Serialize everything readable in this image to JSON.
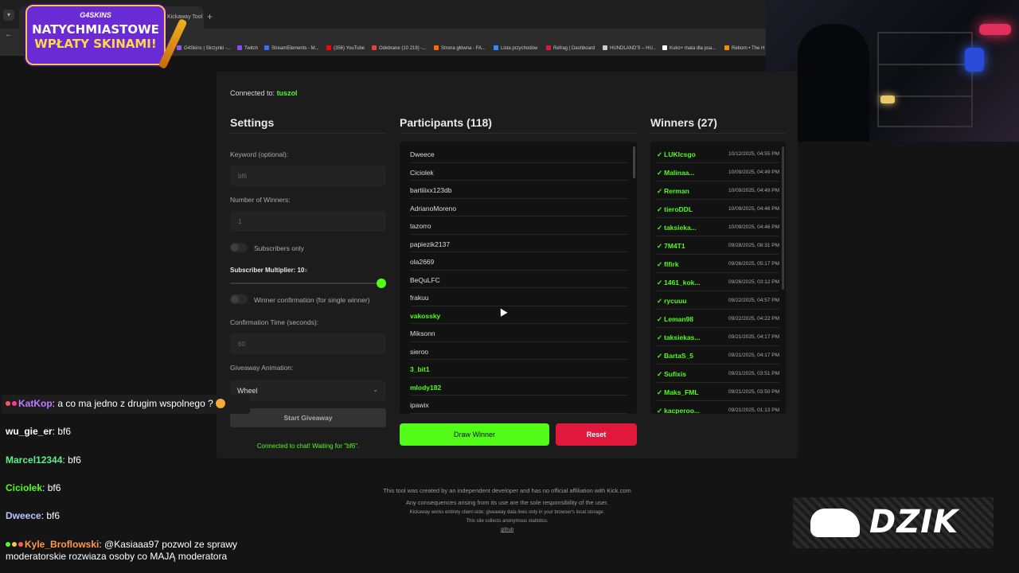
{
  "browser": {
    "tab_title": "Kickaway Tool",
    "bookmarks": [
      {
        "label": "G4Skins | Skrzynki -...",
        "color": "#8a5cf6"
      },
      {
        "label": "Twitch",
        "color": "#9146ff"
      },
      {
        "label": "StreamElements - M...",
        "color": "#3b6cff"
      },
      {
        "label": "(356) YouTube",
        "color": "#ff0000"
      },
      {
        "label": "Odebrane (10 219) -...",
        "color": "#ea4335"
      },
      {
        "label": "Strona główna - FA...",
        "color": "#ff6a00"
      },
      {
        "label": "Lista przychodów",
        "color": "#2d8cff"
      },
      {
        "label": "Refrag | Dashboard",
        "color": "#e0183c"
      },
      {
        "label": "HUNDLAND'S – HU...",
        "color": "#cccccc"
      },
      {
        "label": "Kuko+ mata dla psa...",
        "color": "#ffffff"
      },
      {
        "label": "Reborn • The H",
        "color": "#ff8a00"
      }
    ]
  },
  "promo": {
    "brand": "G4SKINS",
    "line1": "NATYCHMIASTOWE",
    "line2": "WPŁATY SKINAMI!"
  },
  "panel": {
    "connected_label": "Connected to:",
    "channel": "tuszol",
    "settings_title": "Settings",
    "keyword_label": "Keyword (optional):",
    "keyword_value": "bf6",
    "winners_label": "Number of Winners:",
    "winners_value": "1",
    "subscribers_only_label": "Subscribers only",
    "multiplier_label": "Subscriber Multiplier: 10",
    "multiplier_unit": "x",
    "multiplier_level": 1.0,
    "winner_confirmation_label": "Winner confirmation (for single winner)",
    "confirmation_time_label": "Confirmation Time (seconds):",
    "confirmation_time_value": "60",
    "animation_label": "Giveaway Animation:",
    "animation_value": "Wheel",
    "start_button": "Start Giveaway",
    "chat_status": "Connected to chat! Waiting for \"bf6\".",
    "participants_title": "Participants (118)",
    "participants": [
      {
        "name": "Dweece",
        "sub": false
      },
      {
        "name": "Ciciolek",
        "sub": false
      },
      {
        "name": "bartiiixx123db",
        "sub": false
      },
      {
        "name": "AdrianoMoreno",
        "sub": false
      },
      {
        "name": "tazorro",
        "sub": false
      },
      {
        "name": "papiezik2137",
        "sub": false
      },
      {
        "name": "ola2669",
        "sub": false
      },
      {
        "name": "BeQuLFC",
        "sub": false
      },
      {
        "name": "frakuu",
        "sub": false
      },
      {
        "name": "vakossky",
        "sub": true
      },
      {
        "name": "Miksonn",
        "sub": false
      },
      {
        "name": "sieroo",
        "sub": false
      },
      {
        "name": "3_bit1",
        "sub": true
      },
      {
        "name": "mlody182",
        "sub": true
      },
      {
        "name": "ipawix",
        "sub": false
      }
    ],
    "draw_button": "Draw Winner",
    "reset_button": "Reset",
    "winners_title": "Winners (27)",
    "winners": [
      {
        "name": "LUKIcsgo",
        "date": "10/12/2025, 04:55 PM"
      },
      {
        "name": "Malinaa...",
        "date": "10/09/2025, 04:49 PM"
      },
      {
        "name": "Rerman",
        "date": "10/09/2025, 04:49 PM"
      },
      {
        "name": "tieroDDL",
        "date": "10/09/2025, 04:46 PM"
      },
      {
        "name": "taksieka...",
        "date": "10/09/2025, 04:46 PM"
      },
      {
        "name": "7M4T1",
        "date": "09/28/2025, 08:31 PM"
      },
      {
        "name": "flfirk",
        "date": "09/26/2025, 05:17 PM"
      },
      {
        "name": "1461_kok...",
        "date": "09/26/2025, 03:12 PM"
      },
      {
        "name": "rycuuu",
        "date": "09/22/2025, 04:57 PM"
      },
      {
        "name": "Leman98",
        "date": "09/22/2025, 04:22 PM"
      },
      {
        "name": "taksiekas...",
        "date": "09/21/2025, 04:17 PM"
      },
      {
        "name": "BartaS_5",
        "date": "09/21/2025, 04:17 PM"
      },
      {
        "name": "Sufixis",
        "date": "09/21/2025, 03:51 PM"
      },
      {
        "name": "Maks_FML",
        "date": "09/21/2025, 03:50 PM"
      },
      {
        "name": "kacperoo...",
        "date": "09/21/2025, 01:13 PM"
      }
    ]
  },
  "footer": {
    "line1": "This tool was created by an independent developer and has no official affiliation with Kick.com",
    "line2": "Any consequences arising from its use are the sole responsibility of the user.",
    "line3": "Kickaway works entirely client-side; giveaway data lives only in your browser's local storage.",
    "line4": "This site collects anonymous statistics.",
    "line5": "github"
  },
  "chat": [
    {
      "user": "KatKop",
      "color": "#c07bff",
      "text": "a co ma jedno z drugim wspolnego ?",
      "badges": [
        "#ff5a5a",
        "#ff3b8a"
      ],
      "emoji": true
    },
    {
      "user": "wu_gie_er",
      "color": "#ffffff",
      "text": "bf6",
      "badges": [],
      "emoji": false
    },
    {
      "user": "Marcel12344",
      "color": "#5cf08a",
      "text": "bf6",
      "badges": [],
      "emoji": false
    },
    {
      "user": "Ciciolek",
      "color": "#53fc18",
      "text": "bf6",
      "badges": [],
      "emoji": false
    },
    {
      "user": "Dweece",
      "color": "#b8c6ff",
      "text": "bf6",
      "badges": [],
      "emoji": false
    },
    {
      "user": "Kyle_Broflowski",
      "color": "#ff9a4a",
      "text": "@Kasiaaa97 pozwol ze sprawy",
      "badges": [
        "#53fc18",
        "#f4c84a",
        "#ff5a5a"
      ],
      "emoji": false
    },
    {
      "user": "",
      "color": "#ffffff",
      "text": "moderatorskie rozwiaza osoby co MAJĄ moderatora",
      "badges": [],
      "emoji": false
    }
  ],
  "logo": {
    "text": "DZIK"
  }
}
